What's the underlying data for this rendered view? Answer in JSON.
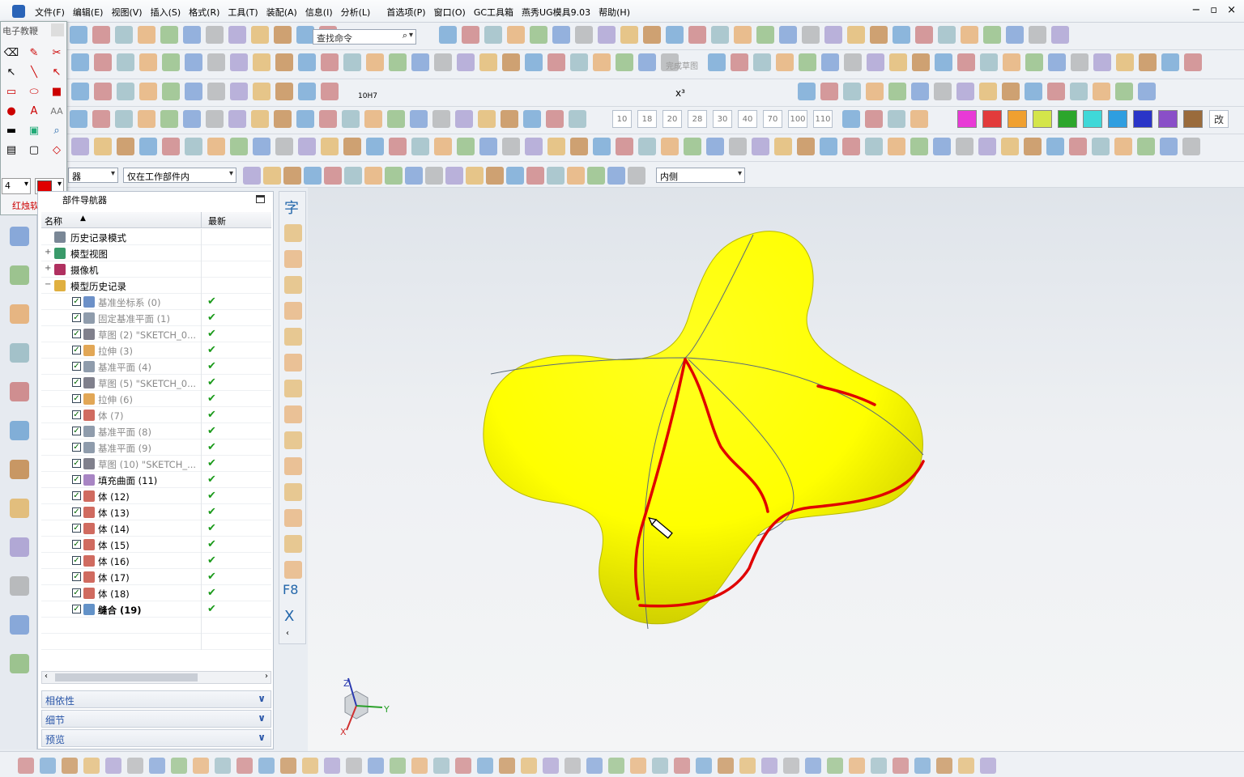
{
  "app": {
    "menus": [
      "文件(F)",
      "编辑(E)",
      "视图(V)",
      "插入(S)",
      "格式(R)",
      "工具(T)",
      "装配(A)",
      "信息(I)",
      "分析(L)",
      "首选项(P)",
      "窗口(O)",
      "GC工具箱",
      "燕秀UG模具9.03",
      "帮助(H)"
    ],
    "window_controls": [
      "−",
      "▫",
      "×"
    ]
  },
  "toolbar": {
    "search_placeholder": "查找命令",
    "sketch_finish": "完成草图",
    "hole_label": "10H7",
    "x3_label": "x³",
    "numbers": [
      "10",
      "18",
      "20",
      "28",
      "30",
      "40",
      "70",
      "100",
      "110"
    ],
    "swatch_colors": [
      "#e83ad6",
      "#e23b3b",
      "#f0a030",
      "#d4e54a",
      "#2ca62c",
      "#3fd8d8",
      "#2f9ee0",
      "#2a35c8",
      "#8a4fc8",
      "#9a6b3c"
    ],
    "swatch_text": "改",
    "filter_type": "器",
    "filter_scope": "仅在工作部件内",
    "filter_side": "内侧"
  },
  "palette": {
    "title": "电子教鞭",
    "size_value": "4",
    "brand": "红烛软件",
    "pen_color": "#e00000"
  },
  "navigator": {
    "title": "部件导航器",
    "col_name": "名称",
    "col_latest": "最新",
    "top_items": [
      {
        "label": "历史记录模式",
        "expander": ""
      },
      {
        "label": "模型视图",
        "expander": "+"
      },
      {
        "label": "摄像机",
        "expander": "+"
      },
      {
        "label": "模型历史记录",
        "expander": "−"
      }
    ],
    "features": [
      {
        "label": "基准坐标系 (0)",
        "dim": true,
        "bold": false,
        "icon": "#3b6bb5"
      },
      {
        "label": "固定基准平面 (1)",
        "dim": true,
        "bold": false,
        "icon": "#6a7b90"
      },
      {
        "label": "草图 (2) \"SKETCH_0...",
        "dim": true,
        "bold": false,
        "icon": "#556"
      },
      {
        "label": "拉伸 (3)",
        "dim": true,
        "bold": false,
        "icon": "#d88a1e"
      },
      {
        "label": "基准平面 (4)",
        "dim": true,
        "bold": false,
        "icon": "#6a7b90"
      },
      {
        "label": "草图 (5) \"SKETCH_0...",
        "dim": true,
        "bold": false,
        "icon": "#556"
      },
      {
        "label": "拉伸 (6)",
        "dim": true,
        "bold": false,
        "icon": "#d88a1e"
      },
      {
        "label": "体 (7)",
        "dim": true,
        "bold": false,
        "icon": "#c0392b"
      },
      {
        "label": "基准平面 (8)",
        "dim": true,
        "bold": false,
        "icon": "#6a7b90"
      },
      {
        "label": "基准平面 (9)",
        "dim": true,
        "bold": false,
        "icon": "#6a7b90"
      },
      {
        "label": "草图 (10) \"SKETCH_...",
        "dim": true,
        "bold": false,
        "icon": "#556"
      },
      {
        "label": "填充曲面 (11)",
        "dim": false,
        "bold": false,
        "icon": "#8b5cb0"
      },
      {
        "label": "体 (12)",
        "dim": false,
        "bold": false,
        "icon": "#c0392b"
      },
      {
        "label": "体 (13)",
        "dim": false,
        "bold": false,
        "icon": "#c0392b"
      },
      {
        "label": "体 (14)",
        "dim": false,
        "bold": false,
        "icon": "#c0392b"
      },
      {
        "label": "体 (15)",
        "dim": false,
        "bold": false,
        "icon": "#c0392b"
      },
      {
        "label": "体 (16)",
        "dim": false,
        "bold": false,
        "icon": "#c0392b"
      },
      {
        "label": "体 (17)",
        "dim": false,
        "bold": false,
        "icon": "#c0392b"
      },
      {
        "label": "体 (18)",
        "dim": false,
        "bold": false,
        "icon": "#c0392b"
      },
      {
        "label": "缝合 (19)",
        "dim": false,
        "bold": true,
        "icon": "#2f6db5"
      }
    ],
    "panels": [
      "相依性",
      "细节",
      "预览"
    ]
  },
  "vertical_bar": {
    "glyphs": [
      "字",
      "F8",
      "X"
    ]
  },
  "viewport": {
    "body_color": "#ffff00",
    "annotation_color": "#e00000",
    "triad": {
      "z": "Z",
      "y": "Y",
      "x": "X"
    }
  }
}
